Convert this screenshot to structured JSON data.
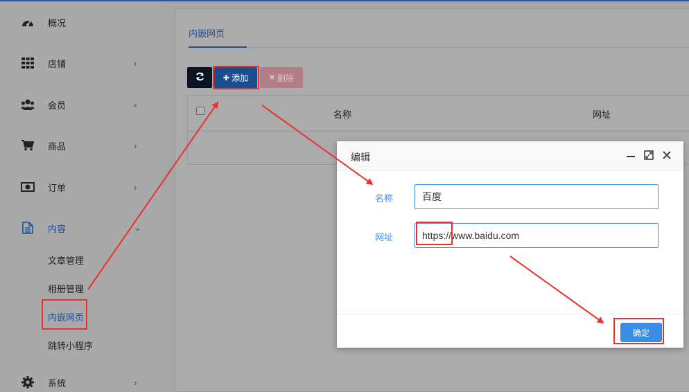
{
  "sidebar": {
    "items": [
      {
        "label": "概况",
        "icon": "dashboard-icon"
      },
      {
        "label": "店铺",
        "icon": "grid-icon",
        "chevron": "›"
      },
      {
        "label": "会员",
        "icon": "users-icon",
        "chevron": "›"
      },
      {
        "label": "商品",
        "icon": "cart-icon",
        "chevron": "›"
      },
      {
        "label": "订单",
        "icon": "money-icon",
        "chevron": "›"
      },
      {
        "label": "内容",
        "icon": "document-icon",
        "chevron": "⌄"
      },
      {
        "label": "系统",
        "icon": "gear-icon",
        "chevron": "›"
      }
    ],
    "subitems": [
      "文章管理",
      "相册管理",
      "内嵌网页",
      "跳转小程序"
    ]
  },
  "main": {
    "tab": "内嵌网页",
    "toolbar": {
      "refresh_icon": "refresh-icon",
      "add_label": "添加",
      "add_symbol": "✚",
      "delete_label": "删除",
      "delete_symbol": "✖"
    },
    "table": {
      "columns": [
        "名称",
        "网址"
      ]
    }
  },
  "dialog": {
    "title": "编辑",
    "fields": {
      "name_label": "名称",
      "name_value": "百度",
      "url_label": "网址",
      "url_value": "https://www.baidu.com"
    },
    "confirm_label": "确定"
  },
  "colors": {
    "accent": "#3a8ee6",
    "highlight": "#e8322e",
    "active_nav": "#1e4f98"
  }
}
